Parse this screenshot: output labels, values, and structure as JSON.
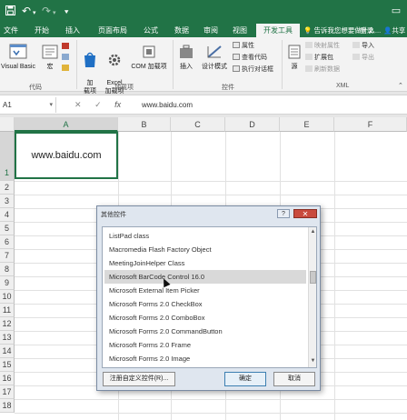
{
  "titlebar": {
    "save_icon": "save-icon",
    "undo_icon": "undo-icon",
    "redo_icon": "redo-icon",
    "customize_icon": "qat-dropdown-icon",
    "accent": "#217346"
  },
  "tabs": [
    {
      "label": "文件"
    },
    {
      "label": "开始"
    },
    {
      "label": "插入"
    },
    {
      "label": "页面布局"
    },
    {
      "label": "公式"
    },
    {
      "label": "数据"
    },
    {
      "label": "审阅"
    },
    {
      "label": "视图"
    },
    {
      "label": "开发工具",
      "active": true
    }
  ],
  "tellme": "告诉我您想要做什么...",
  "login": "登录",
  "share": "共享",
  "ribbon": {
    "code": {
      "visual_basic": "Visual Basic",
      "macro": "宏",
      "group": "代码"
    },
    "addins": {
      "addin": "加\n载项",
      "excel_addin": "Excel\n加载项",
      "com_addin": "COM 加载项",
      "group": "加载项"
    },
    "controls": {
      "insert": "插入",
      "design_mode": "设计模式",
      "properties": "属性",
      "view_code": "查看代码",
      "run_dialog": "执行对话框",
      "group": "控件"
    },
    "xml": {
      "source": "源",
      "map_properties": "映射属性",
      "expansion_packs": "扩展包",
      "refresh_data": "刷新数据",
      "import": "导入",
      "export": "导出",
      "group": "XML"
    }
  },
  "formula_bar": {
    "name_box": "A1",
    "cancel": "✕",
    "enter": "✓",
    "fx": "fx",
    "formula": "www.baidu.com"
  },
  "grid": {
    "columns": [
      "A",
      "B",
      "C",
      "D",
      "E",
      "F"
    ],
    "rows": [
      "1",
      "2",
      "3",
      "4",
      "5",
      "6",
      "7",
      "8",
      "9",
      "10",
      "11",
      "12",
      "13",
      "14",
      "15",
      "16",
      "17",
      "18"
    ],
    "a1_value": "www.baidu.com"
  },
  "dialog": {
    "title": "其他控件",
    "help": "?",
    "close": "✕",
    "items": [
      "ListPad class",
      "Macromedia Flash Factory Object",
      "MeetingJoinHelper Class",
      "Microsoft BarCode Control 16.0",
      "Microsoft External Item Picker",
      "Microsoft Forms 2.0 CheckBox",
      "Microsoft Forms 2.0 ComboBox",
      "Microsoft Forms 2.0 CommandButton",
      "Microsoft Forms 2.0 Frame",
      "Microsoft Forms 2.0 Image"
    ],
    "selected_index": 3,
    "register_button": "注册自定义控件(R)...",
    "ok_button": "确定",
    "cancel_button": "取消"
  }
}
